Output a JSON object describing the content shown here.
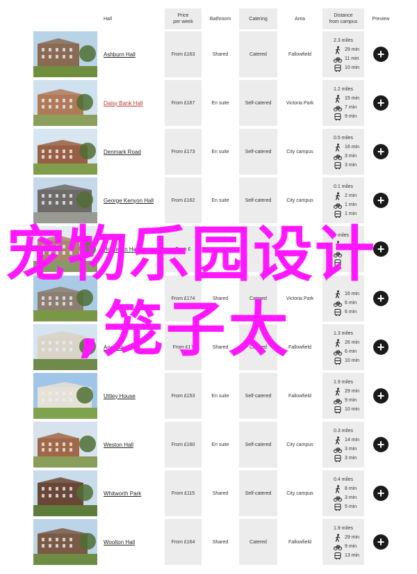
{
  "header": {
    "hall": "Hall",
    "price": "Price\nper week",
    "bathroom": "Bathroom",
    "catering": "Catering",
    "area": "Area",
    "distance": "Distance\nfrom campus",
    "preview": "Preview"
  },
  "halls": [
    {
      "name": "Ashburn Hall",
      "price": "From £163",
      "bathroom": "Shared",
      "catering": "Catered",
      "area": "Fallowfield",
      "walk_miles": "2.3 miles",
      "walk": "29 min",
      "bike": "11 min",
      "bus": "10 min",
      "name_color": "#222222"
    },
    {
      "name": "Daisy Bank Hall",
      "price": "From £167",
      "bathroom": "En suite",
      "catering": "Self-catered",
      "area": "Victoria Park",
      "walk_miles": "1.2 miles",
      "walk": "15 min",
      "bike": "7 min",
      "bus": "9 min",
      "name_color": "#c0392b"
    },
    {
      "name": "Denmark Road",
      "price": "From £173",
      "bathroom": "En suite",
      "catering": "Self-catered",
      "area": "City campus",
      "walk_miles": "0.5 miles",
      "walk": "16 min",
      "bike": "3 min",
      "bus": "3 min",
      "name_color": "#222222"
    },
    {
      "name": "George Kenyon Hall",
      "price": "From £162",
      "bathroom": "En suite",
      "catering": "Self-catered",
      "area": "City campus",
      "walk_miles": "0.1 miles",
      "walk": "2 min",
      "bike": "1 min",
      "bus": "1 min",
      "name_color": "#222222"
    },
    {
      "name": "Horniman House",
      "price": "From £",
      "bathroom": "",
      "catering": "",
      "area": "",
      "walk_miles": "3 miles",
      "walk": "",
      "bike": "",
      "bus": "",
      "name_color": "#222222"
    },
    {
      "name": "",
      "price": "From £174",
      "bathroom": "Shared",
      "catering": "Catered",
      "area": "Victoria Park",
      "walk_miles": "",
      "walk": "16 min",
      "bike": "6 min",
      "bus": "6 min",
      "name_color": "#222222"
    },
    {
      "name": "Ancoats",
      "price": "From £17",
      "bathroom": "Shared",
      "catering": "Catered",
      "area": "Fallowfield",
      "walk_miles": "1.3 miles",
      "walk": "26 min",
      "bike": "6 min",
      "bus": "10 min",
      "name_color": "#222222"
    },
    {
      "name": "Uttley House",
      "price": "From £153",
      "bathroom": "En suite",
      "catering": "Self-catered",
      "area": "Fallowfield",
      "walk_miles": "1.9 miles",
      "walk": "29 min",
      "bike": "9 min",
      "bus": "10 min",
      "name_color": "#222222"
    },
    {
      "name": "Weston Hall",
      "price": "From £160",
      "bathroom": "En suite",
      "catering": "Self-catered",
      "area": "City campus",
      "walk_miles": "0.3 miles",
      "walk": "14 min",
      "bike": "3 min",
      "bus": "3 min",
      "name_color": "#222222"
    },
    {
      "name": "Whitworth Park",
      "price": "From £115",
      "bathroom": "Shared",
      "catering": "Self-catered",
      "area": "City campus",
      "walk_miles": "0.4 miles",
      "walk": "8 min",
      "bike": "3 min",
      "bus": "5 min",
      "name_color": "#222222"
    },
    {
      "name": "Woolton Hall",
      "price": "From £164",
      "bathroom": "Shared",
      "catering": "Catered",
      "area": "Fallowfield",
      "walk_miles": "1.9 miles",
      "walk": "29 min",
      "bike": "9 min",
      "bus": "13 min",
      "name_color": "#222222"
    }
  ],
  "overlay": {
    "line1": "宠物乐园设计",
    "line2": ",笼子太"
  },
  "colors": {
    "shade": "#ececec",
    "overlay": "#ff18ff",
    "link": "#222222",
    "link_active": "#c0392b",
    "preview_button": "#1a1a1a"
  },
  "icons": {
    "walk": "walk-icon",
    "bike": "bike-icon",
    "bus": "bus-icon",
    "preview": "plus-icon"
  }
}
